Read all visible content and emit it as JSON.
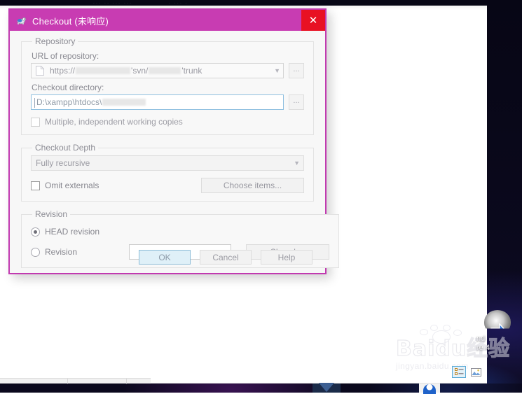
{
  "dialog": {
    "title": "Checkout (未响应)",
    "app_icon": "tortoisesvn-icon",
    "close_label": "✕",
    "accent_color": "#c83cb2",
    "close_color": "#e81123",
    "groups": {
      "repository": {
        "legend": "Repository",
        "url_label": "URL of repository:",
        "url_prefix": "https://",
        "url_mid": "'svn/",
        "url_suffix": "'trunk",
        "url_browse": "...",
        "dir_label": "Checkout directory:",
        "dir_value": "D:\\xampp\\htdocs\\",
        "dir_browse": "...",
        "multiple_label": "Multiple, independent working copies"
      },
      "depth": {
        "legend": "Checkout Depth",
        "selected": "Fully recursive",
        "omit_externals_label": "Omit externals",
        "choose_items_label": "Choose items..."
      },
      "revision": {
        "legend": "Revision",
        "head_label": "HEAD revision",
        "revision_label": "Revision",
        "revision_value": "",
        "show_log_label": "Show log"
      }
    },
    "buttons": {
      "ok": "OK",
      "cancel": "Cancel",
      "help": "Help"
    }
  },
  "desktop": {
    "icon_label": "nd\nre 4",
    "icon_name": "desktop-shortcut-icon",
    "bg_top_text_1": "··· ·· ··· ···",
    "bg_top_text_2": "· ··· ·"
  },
  "watermark": {
    "brand": "Baidu",
    "brand_cn": "经验",
    "url": "jingyan.baidu.com"
  },
  "tray": {
    "items": [
      "list-view-icon",
      "image-view-icon"
    ]
  }
}
